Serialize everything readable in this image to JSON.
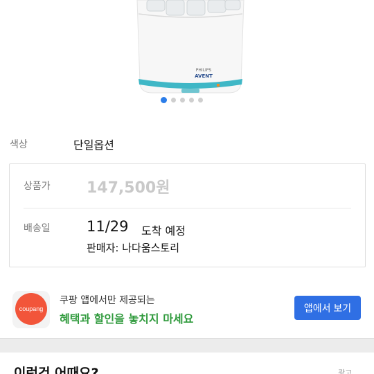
{
  "gallery": {
    "brand_mark": "AVENT",
    "sub_brand": "PHILIPS",
    "slide_count": 5,
    "active_slide": 1
  },
  "option": {
    "label": "색상",
    "value": "단일옵션"
  },
  "info": {
    "price_label": "상품가",
    "price_value": "147,500원",
    "shipping_label": "배송일",
    "shipping_date": "11/29",
    "shipping_suffix": "도착 예정",
    "seller": "판매자: 나다움스토리"
  },
  "banner": {
    "logo_text": "coupang",
    "line1": "쿠팡 앱에서만 제공되는",
    "line2": "혜택과 할인을 놓치지 마세요",
    "button_label": "앱에서 보기",
    "accent_color": "#2f6fe4",
    "highlight_color": "#2f9a3c",
    "logo_color": "#f2553a"
  },
  "recommend": {
    "title": "이런건 어때요?",
    "ad_label": "광고"
  }
}
